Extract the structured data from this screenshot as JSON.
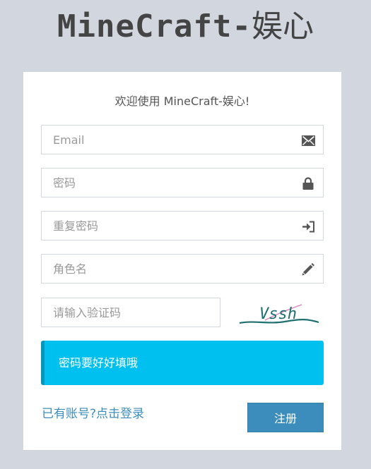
{
  "logo": {
    "title_en": "MineCraft-",
    "title_cn": "娱心"
  },
  "form": {
    "welcome": "欢迎使用 MineCraft-娱心!",
    "email": {
      "placeholder": "Email",
      "value": "",
      "icon": "envelope-icon"
    },
    "password": {
      "placeholder": "密码",
      "value": "",
      "icon": "lock-icon"
    },
    "password_repeat": {
      "placeholder": "重复密码",
      "value": "",
      "icon": "sign-in-icon"
    },
    "character_name": {
      "placeholder": "角色名",
      "value": "",
      "icon": "pencil-icon"
    },
    "captcha": {
      "placeholder": "请输入验证码",
      "value": "",
      "image_text": "Vssh"
    },
    "notice": "密码要好好填哦",
    "login_link": "已有账号?点击登录",
    "register_button": "注册"
  },
  "colors": {
    "background": "#d2d6de",
    "primary": "#3c8dbc",
    "notice": "#00c0ef",
    "icon": "#555555"
  }
}
